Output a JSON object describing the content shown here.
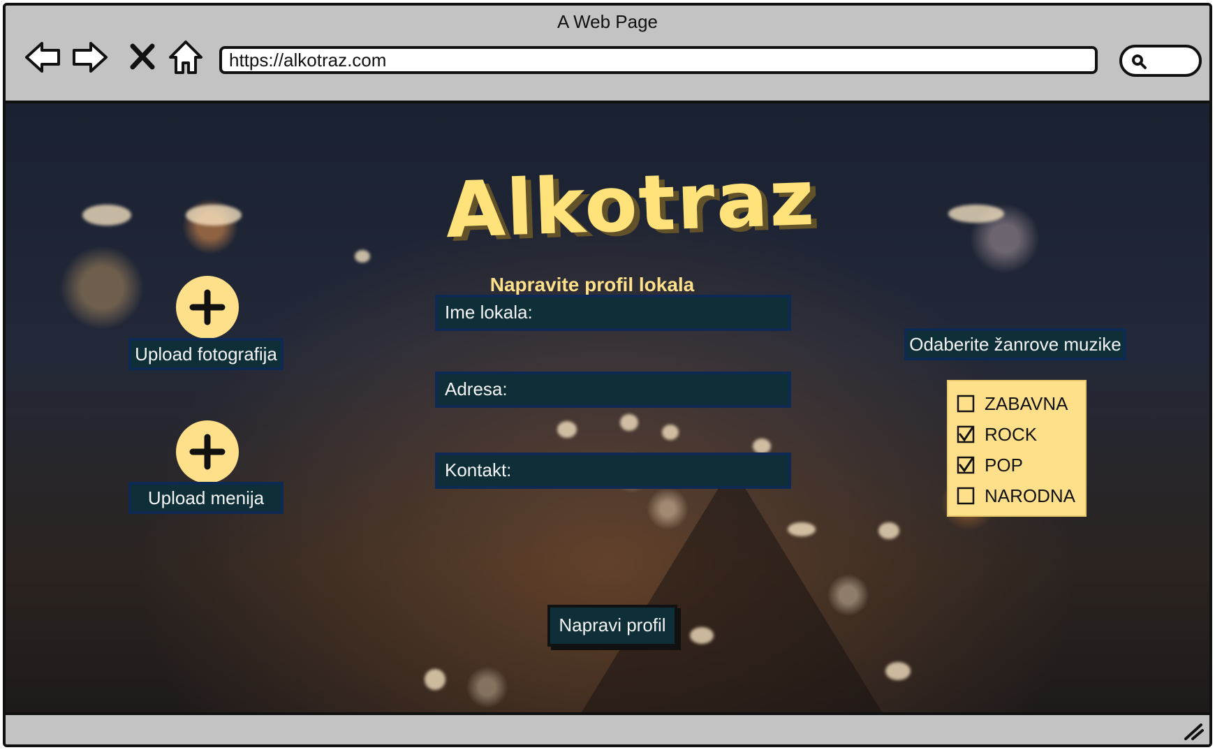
{
  "window": {
    "title": "A Web Page"
  },
  "browser": {
    "url": "https://alkotraz.com"
  },
  "page": {
    "brand": "Alkotraz",
    "subtitle": "Napravite profil lokala",
    "fields": {
      "name_label": "Ime lokala:",
      "address_label": "Adresa:",
      "contact_label": "Kontakt:"
    },
    "uploads": {
      "photos_label": "Upload fotografija",
      "menu_label": "Upload menija"
    },
    "genres": {
      "title": "Odaberite žanrove muzike",
      "options": [
        {
          "label": "ZABAVNA",
          "checked": false
        },
        {
          "label": "ROCK",
          "checked": true
        },
        {
          "label": "POP",
          "checked": true
        },
        {
          "label": "NARODNA",
          "checked": false
        }
      ]
    },
    "submit_label": "Napravi profil"
  },
  "colors": {
    "accent_yellow": "#ffe08a",
    "field_bg": "#0f2f38",
    "field_border": "#0d2a55",
    "chrome_gray": "#c3c3c3"
  },
  "icons": [
    "back-icon",
    "forward-icon",
    "close-icon",
    "home-icon",
    "search-icon",
    "plus-icon",
    "resize-icon",
    "checkbox-icon"
  ]
}
